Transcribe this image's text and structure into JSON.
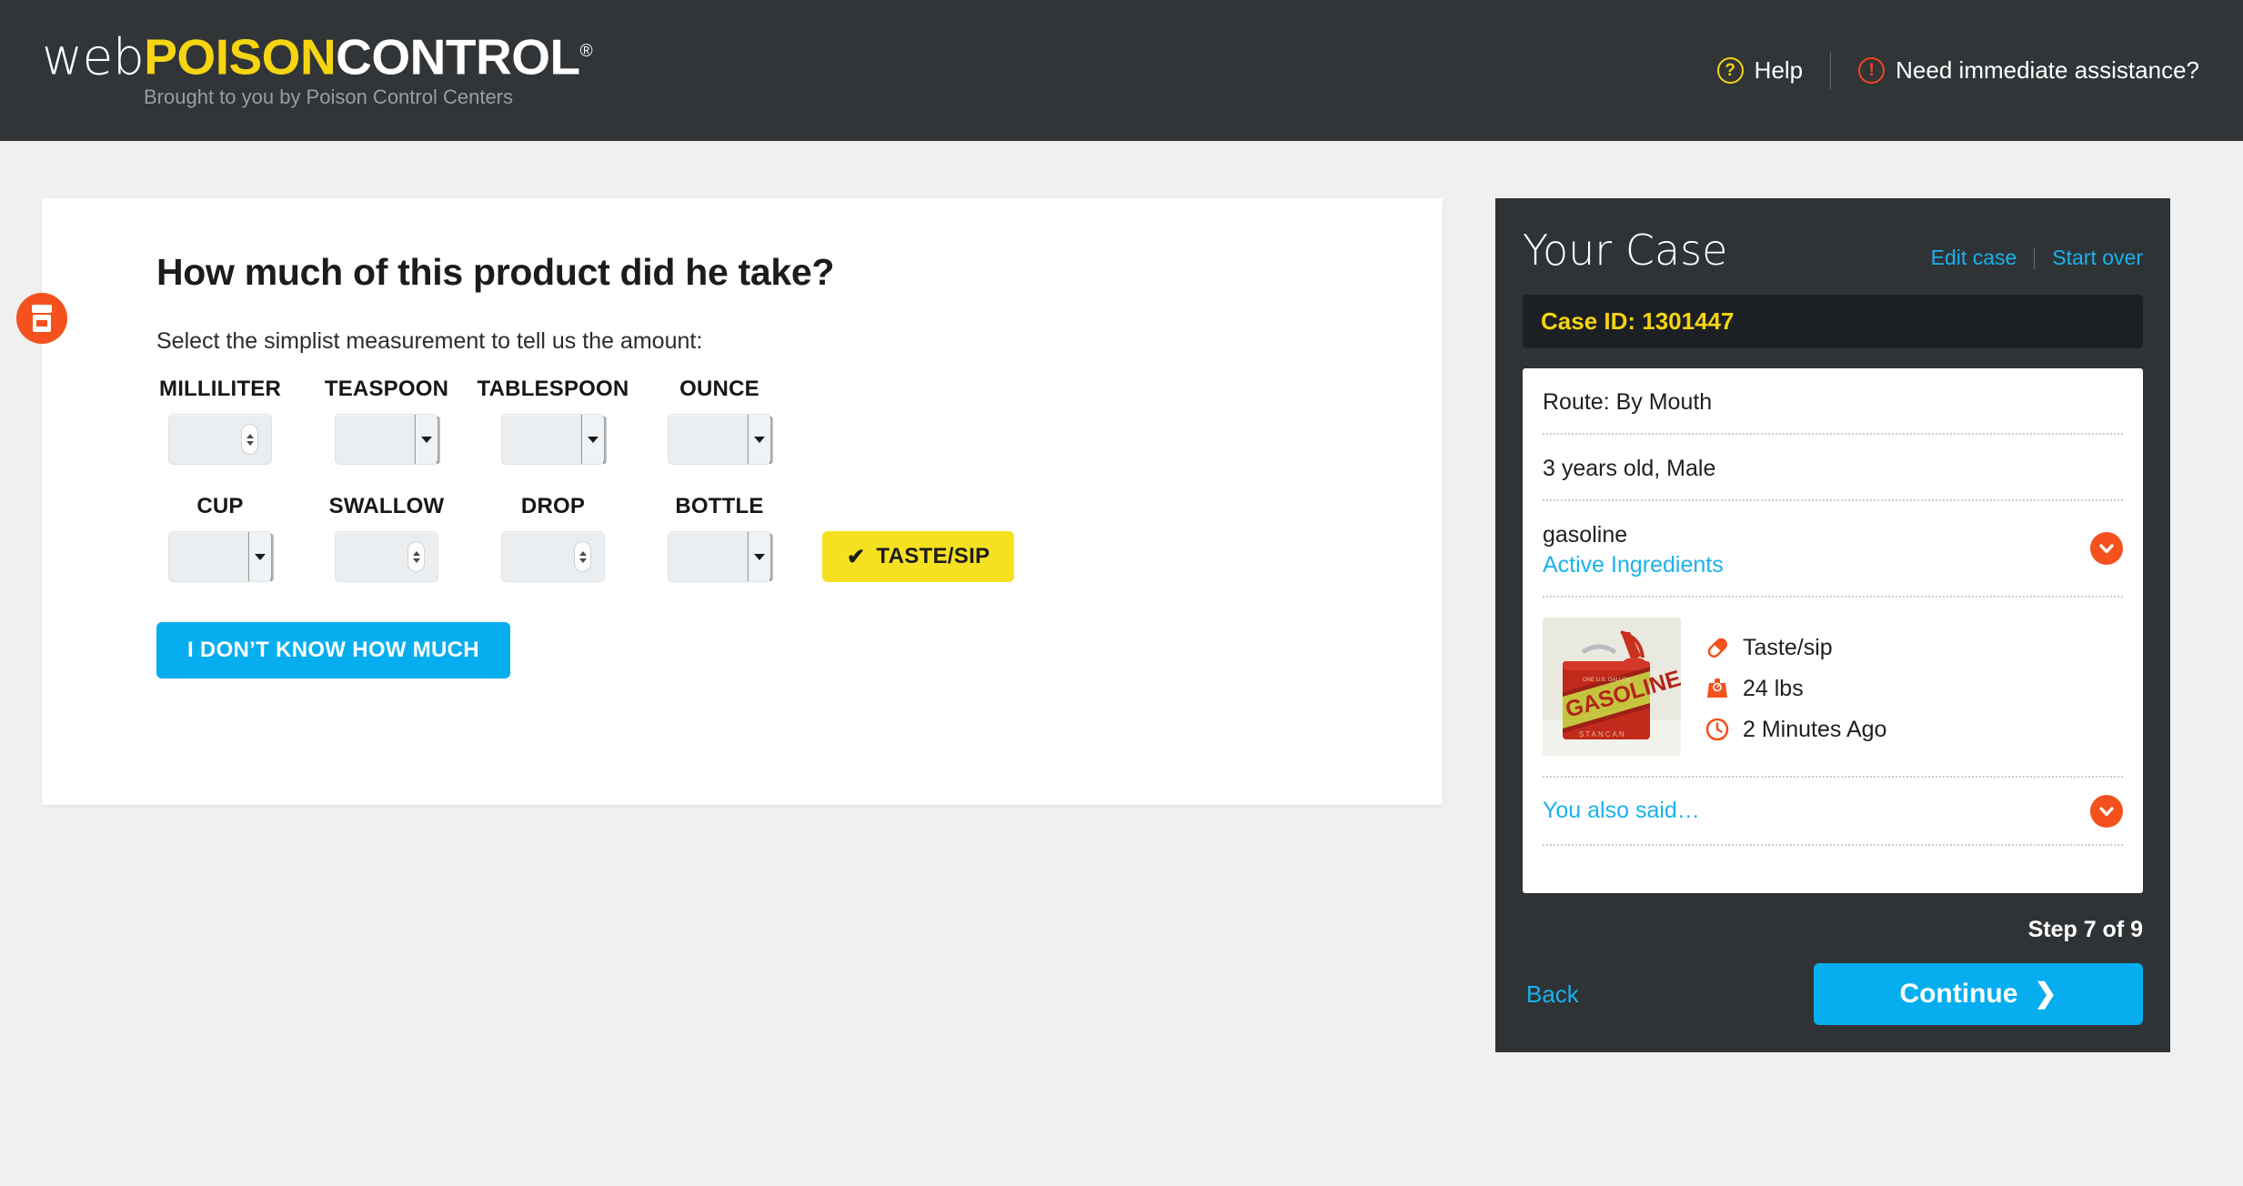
{
  "header": {
    "brand": {
      "part1": "web",
      "part2": "POISON",
      "part3": "CONTROL",
      "registered": "®"
    },
    "tagline": "Brought to you by Poison Control Centers",
    "help_label": "Help",
    "help_icon": "question-circle-icon",
    "assistance_label": "Need immediate assistance?",
    "assistance_icon": "exclamation-circle-icon",
    "help_icon_color": "#f5d412",
    "assistance_icon_color": "#f1461b",
    "background_color": "#313538"
  },
  "main": {
    "step_icon": "medicine-bottle-icon",
    "title": "How much of this product did he take?",
    "subtitle": "Select the simplist measurement to tell us the amount:",
    "measurements": [
      {
        "label": "MILLILITER",
        "type": "number",
        "value": ""
      },
      {
        "label": "TEASPOON",
        "type": "select",
        "value": ""
      },
      {
        "label": "TABLESPOON",
        "type": "select",
        "value": ""
      },
      {
        "label": "OUNCE",
        "type": "select",
        "value": ""
      },
      {
        "label": "CUP",
        "type": "select",
        "value": ""
      },
      {
        "label": "SWALLOW",
        "type": "number",
        "value": ""
      },
      {
        "label": "DROP",
        "type": "number",
        "value": ""
      },
      {
        "label": "BOTTLE",
        "type": "select",
        "value": ""
      }
    ],
    "taste_sip_label": "TASTE/SIP",
    "taste_sip_check": "✔",
    "dont_know_label": "I DON’T KNOW HOW MUCH",
    "taste_sip_color": "#f5e120",
    "dont_know_color": "#06aeef"
  },
  "case": {
    "title": "Your Case",
    "edit_label": "Edit case",
    "start_over_label": "Start over",
    "case_id_label": "Case ID: 1301447",
    "route": "Route: By Mouth",
    "patient": "3 years old, Male",
    "product_name": "gasoline",
    "active_ingredients_label": "Active Ingredients",
    "product_image_alt": "GASOLINE can",
    "product_image_text": {
      "top": "ONE U.S. GALLON",
      "middle": "GASOLINE",
      "bottom": "STANCAN"
    },
    "details": [
      {
        "icon": "pill-icon",
        "text": "Taste/sip"
      },
      {
        "icon": "scale-icon",
        "text": "24 lbs"
      },
      {
        "icon": "clock-icon",
        "text": "2 Minutes Ago"
      }
    ],
    "also_said_label": "You also said…",
    "step_text": "Step 7 of 9",
    "back_label": "Back",
    "continue_label": "Continue",
    "continue_chevron": "❯",
    "link_color": "#19b2ed",
    "accent_color": "#f4511e",
    "case_id_color": "#f5d412",
    "panel_color": "#2f3336"
  }
}
